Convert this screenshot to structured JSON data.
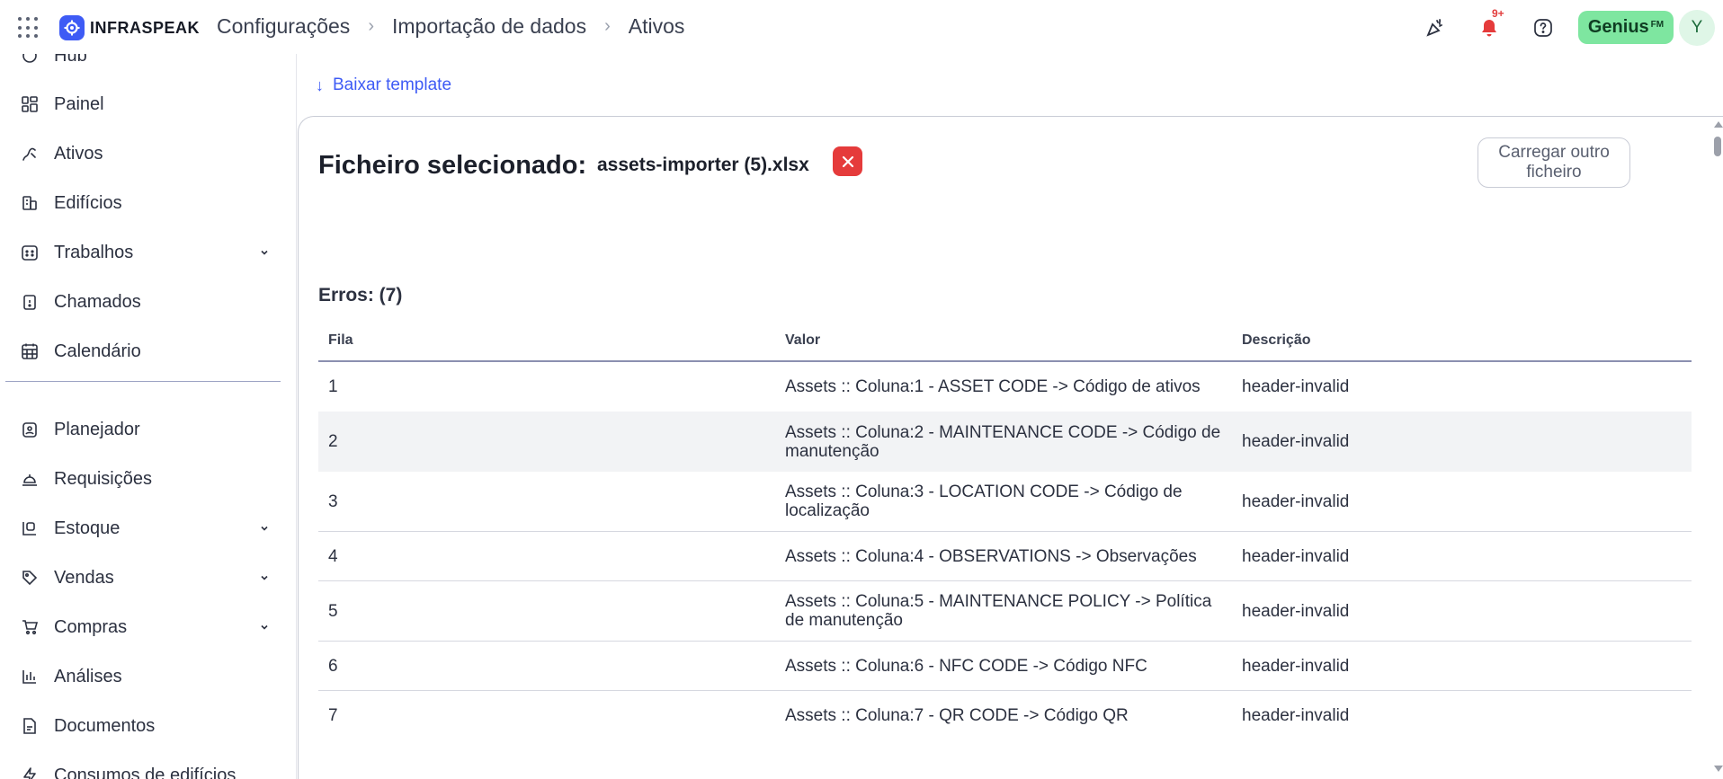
{
  "header": {
    "logo_text": "INFRASPEAK",
    "breadcrumb": [
      "Configurações",
      "Importação de dados",
      "Ativos"
    ],
    "notification_badge": "9+",
    "genius_label": "Genius",
    "genius_suffix": "FM",
    "avatar_initial": "Y"
  },
  "sidebar": {
    "partial_item": "Hub",
    "items": [
      {
        "label": "Painel",
        "icon": "dashboard-icon"
      },
      {
        "label": "Ativos",
        "icon": "assets-icon"
      },
      {
        "label": "Edifícios",
        "icon": "building-icon"
      },
      {
        "label": "Trabalhos",
        "icon": "calendar-grid-icon",
        "expandable": true
      },
      {
        "label": "Chamados",
        "icon": "clipboard-icon"
      },
      {
        "label": "Calendário",
        "icon": "calendar-icon"
      },
      {
        "label": "Planejador",
        "icon": "planner-icon"
      },
      {
        "label": "Requisições",
        "icon": "bell-service-icon"
      },
      {
        "label": "Estoque",
        "icon": "stock-icon",
        "expandable": true
      },
      {
        "label": "Vendas",
        "icon": "tag-icon",
        "expandable": true
      },
      {
        "label": "Compras",
        "icon": "cart-icon",
        "expandable": true
      },
      {
        "label": "Análises",
        "icon": "bar-chart-icon"
      },
      {
        "label": "Documentos",
        "icon": "document-icon"
      },
      {
        "label": "Consumos de edifícios",
        "icon": "bolt-icon"
      }
    ]
  },
  "main": {
    "download_template": "Baixar template",
    "file_label": "Ficheiro selecionado:",
    "file_name": "assets-importer (5).xlsx",
    "load_other": "Carregar outro ficheiro",
    "errors_title": "Erros: (7)",
    "table": {
      "headers": [
        "Fila",
        "Valor",
        "Descrição"
      ],
      "rows": [
        {
          "row": "1",
          "value": "Assets :: Coluna:1 - ASSET CODE -> Código de ativos",
          "description": "header-invalid"
        },
        {
          "row": "2",
          "value": "Assets :: Coluna:2 - MAINTENANCE CODE -> Código de manutenção",
          "description": "header-invalid"
        },
        {
          "row": "3",
          "value": "Assets :: Coluna:3 - LOCATION CODE -> Código de localização",
          "description": "header-invalid"
        },
        {
          "row": "4",
          "value": "Assets :: Coluna:4 - OBSERVATIONS -> Observações",
          "description": "header-invalid"
        },
        {
          "row": "5",
          "value": "Assets :: Coluna:5 - MAINTENANCE POLICY -> Política de manutenção",
          "description": "header-invalid"
        },
        {
          "row": "6",
          "value": "Assets :: Coluna:6 - NFC CODE -> Código NFC",
          "description": "header-invalid"
        },
        {
          "row": "7",
          "value": "Assets :: Coluna:7 - QR CODE -> Código QR",
          "description": "header-invalid"
        }
      ]
    }
  },
  "colors": {
    "accent": "#3e5bf5",
    "danger": "#e53b3b",
    "genius": "#7ee6a0"
  }
}
